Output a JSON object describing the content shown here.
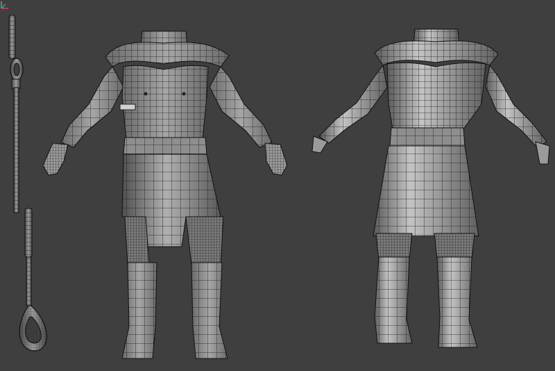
{
  "viewport": {
    "background": "#3f3f3f",
    "mesh_fill": "#8a8a8a",
    "mesh_shade": "#5c5c5c",
    "wire_color": "#1a1a1a",
    "highlight": "#d6d6d6"
  },
  "objects": [
    "staff-model",
    "armor-front-model",
    "armor-back-model"
  ],
  "gizmo": {
    "icon": "axis-gizmo-icon"
  }
}
